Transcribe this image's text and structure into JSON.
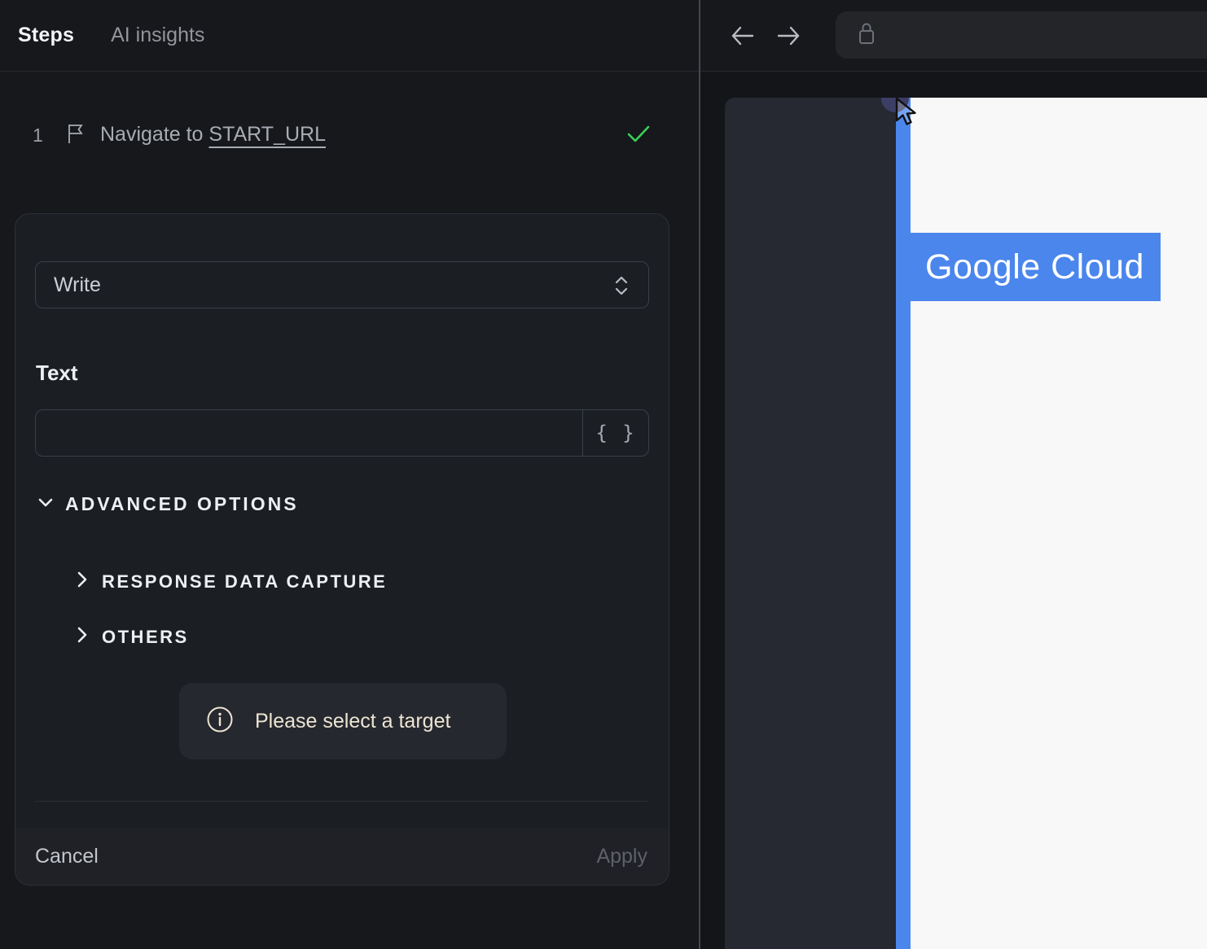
{
  "left_panel": {
    "tabs": [
      {
        "label": "Steps",
        "active": true
      },
      {
        "label": "AI insights",
        "active": false
      }
    ],
    "step": {
      "index": "1",
      "action_text": "Navigate to ",
      "target": "START_URL",
      "status": "success"
    },
    "editor": {
      "action_select": {
        "value": "Write"
      },
      "text_label": "Text",
      "text_input": {
        "value": "",
        "placeholder": ""
      },
      "variable_button_label": "{ }",
      "advanced_options_label": "ADVANCED OPTIONS",
      "sections": [
        {
          "label": "RESPONSE DATA CAPTURE",
          "expanded": false
        },
        {
          "label": "OTHERS",
          "expanded": false
        }
      ],
      "hint": "Please select a target",
      "cancel_label": "Cancel",
      "apply_label": "Apply"
    }
  },
  "browser": {
    "url_bar": {
      "value": ""
    },
    "page": {
      "banner_text": "Google Cloud"
    }
  },
  "colors": {
    "accent_blue": "#4a86ec",
    "success_green": "#38d158",
    "hint_cream": "#ede5d3",
    "panel_bg": "#16181c",
    "card_bg": "#1b1e23",
    "viewport_dark": "#262832",
    "page_white": "#f8f8f9",
    "click_dot_indigo": "#3c3e66"
  }
}
